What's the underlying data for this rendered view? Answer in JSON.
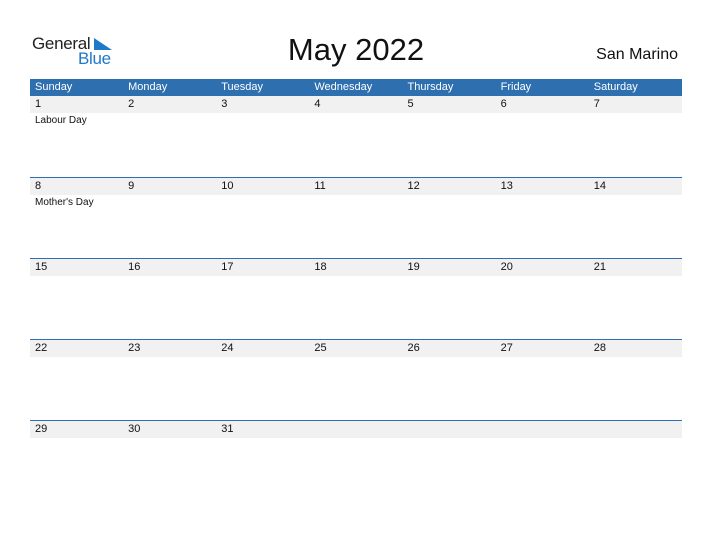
{
  "logo": {
    "word1": "General",
    "word2": "Blue"
  },
  "title": "May 2022",
  "country": "San Marino",
  "weekdays": [
    "Sunday",
    "Monday",
    "Tuesday",
    "Wednesday",
    "Thursday",
    "Friday",
    "Saturday"
  ],
  "weeks": [
    {
      "days": [
        "1",
        "2",
        "3",
        "4",
        "5",
        "6",
        "7"
      ],
      "events": [
        "Labour Day",
        "",
        "",
        "",
        "",
        "",
        ""
      ]
    },
    {
      "days": [
        "8",
        "9",
        "10",
        "11",
        "12",
        "13",
        "14"
      ],
      "events": [
        "Mother's Day",
        "",
        "",
        "",
        "",
        "",
        ""
      ]
    },
    {
      "days": [
        "15",
        "16",
        "17",
        "18",
        "19",
        "20",
        "21"
      ],
      "events": [
        "",
        "",
        "",
        "",
        "",
        "",
        ""
      ]
    },
    {
      "days": [
        "22",
        "23",
        "24",
        "25",
        "26",
        "27",
        "28"
      ],
      "events": [
        "",
        "",
        "",
        "",
        "",
        "",
        ""
      ]
    },
    {
      "days": [
        "29",
        "30",
        "31",
        "",
        "",
        "",
        ""
      ],
      "events": [
        "",
        "",
        "",
        "",
        "",
        "",
        ""
      ]
    }
  ],
  "colors": {
    "accent": "#2e6fb0",
    "logo_blue": "#1f78c8",
    "row_bg": "#f1f1f1"
  }
}
